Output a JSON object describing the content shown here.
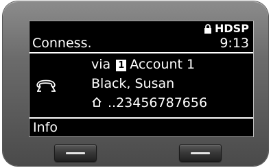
{
  "status_bar": {
    "title": "Conness.",
    "time": "9:13",
    "brand": "HDSP",
    "lock_icon": "lock-icon"
  },
  "call": {
    "via_prefix": "via",
    "account_number": "1",
    "account_name": "Account 1",
    "caller_name": "Black, Susan",
    "number": "..23456787656",
    "status_icon": "handset-icon",
    "number_type_icon": "home-icon"
  },
  "softkeys": {
    "left_label": "Info",
    "right_label": ""
  },
  "colors": {
    "screen_background": "#000000",
    "screen_text": "#ffffff",
    "device_body": "#6b6b6b"
  }
}
